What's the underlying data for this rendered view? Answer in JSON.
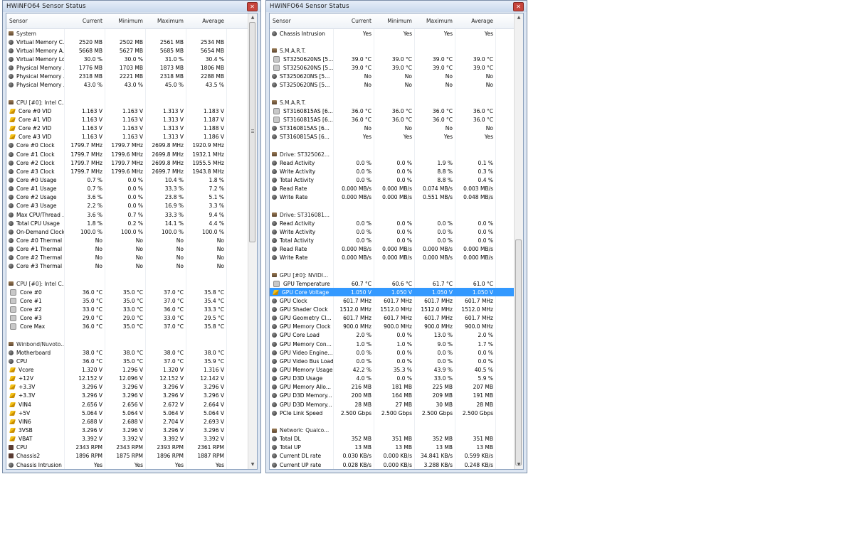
{
  "colors": {
    "selection": "#3399ff",
    "title_bar": "#c9d8ec"
  },
  "columns": [
    "Sensor",
    "Current",
    "Minimum",
    "Maximum",
    "Average"
  ],
  "left_window": {
    "title": "HWiNFO64 Sensor Status",
    "rows": [
      {
        "type": "group",
        "icon": "chip-icon",
        "name": "System"
      },
      {
        "icon": "sensor-icon",
        "name": "Virtual Memory C...",
        "cur": "2520 MB",
        "min": "2502 MB",
        "max": "2561 MB",
        "avg": "2534 MB"
      },
      {
        "icon": "sensor-icon",
        "name": "Virtual Memory A...",
        "cur": "5668 MB",
        "min": "5627 MB",
        "max": "5685 MB",
        "avg": "5654 MB"
      },
      {
        "icon": "sensor-icon",
        "name": "Virtual Memory Load",
        "cur": "30.0 %",
        "min": "30.0 %",
        "max": "31.0 %",
        "avg": "30.4 %"
      },
      {
        "icon": "sensor-icon",
        "name": "Physical Memory ...",
        "cur": "1776 MB",
        "min": "1703 MB",
        "max": "1873 MB",
        "avg": "1806 MB"
      },
      {
        "icon": "sensor-icon",
        "name": "Physical Memory ...",
        "cur": "2318 MB",
        "min": "2221 MB",
        "max": "2318 MB",
        "avg": "2288 MB"
      },
      {
        "icon": "sensor-icon",
        "name": "Physical Memory ...",
        "cur": "43.0 %",
        "min": "43.0 %",
        "max": "45.0 %",
        "avg": "43.5 %"
      },
      {
        "type": "blank"
      },
      {
        "type": "group",
        "icon": "chip-icon",
        "name": "CPU [#0]: Intel C..."
      },
      {
        "icon": "voltage-icon",
        "name": "Core #0 VID",
        "cur": "1.163 V",
        "min": "1.163 V",
        "max": "1.313 V",
        "avg": "1.183 V"
      },
      {
        "icon": "voltage-icon",
        "name": "Core #1 VID",
        "cur": "1.163 V",
        "min": "1.163 V",
        "max": "1.313 V",
        "avg": "1.187 V"
      },
      {
        "icon": "voltage-icon",
        "name": "Core #2 VID",
        "cur": "1.163 V",
        "min": "1.163 V",
        "max": "1.313 V",
        "avg": "1.188 V"
      },
      {
        "icon": "voltage-icon",
        "name": "Core #3 VID",
        "cur": "1.163 V",
        "min": "1.163 V",
        "max": "1.313 V",
        "avg": "1.186 V"
      },
      {
        "icon": "sensor-icon",
        "name": "Core #0 Clock",
        "cur": "1799.7 MHz",
        "min": "1799.7 MHz",
        "max": "2699.8 MHz",
        "avg": "1920.9 MHz"
      },
      {
        "icon": "sensor-icon",
        "name": "Core #1 Clock",
        "cur": "1799.7 MHz",
        "min": "1799.6 MHz",
        "max": "2699.8 MHz",
        "avg": "1932.1 MHz"
      },
      {
        "icon": "sensor-icon",
        "name": "Core #2 Clock",
        "cur": "1799.7 MHz",
        "min": "1799.7 MHz",
        "max": "2699.8 MHz",
        "avg": "1955.5 MHz"
      },
      {
        "icon": "sensor-icon",
        "name": "Core #3 Clock",
        "cur": "1799.7 MHz",
        "min": "1799.6 MHz",
        "max": "2699.7 MHz",
        "avg": "1943.8 MHz"
      },
      {
        "icon": "sensor-icon",
        "name": "Core #0 Usage",
        "cur": "0.7 %",
        "min": "0.0 %",
        "max": "10.4 %",
        "avg": "1.8 %"
      },
      {
        "icon": "sensor-icon",
        "name": "Core #1 Usage",
        "cur": "0.7 %",
        "min": "0.0 %",
        "max": "33.3 %",
        "avg": "7.2 %"
      },
      {
        "icon": "sensor-icon",
        "name": "Core #2 Usage",
        "cur": "3.6 %",
        "min": "0.0 %",
        "max": "23.8 %",
        "avg": "5.1 %"
      },
      {
        "icon": "sensor-icon",
        "name": "Core #3 Usage",
        "cur": "2.2 %",
        "min": "0.0 %",
        "max": "16.9 %",
        "avg": "3.3 %"
      },
      {
        "icon": "sensor-icon",
        "name": "Max CPU/Thread ...",
        "cur": "3.6 %",
        "min": "0.7 %",
        "max": "33.3 %",
        "avg": "9.4 %"
      },
      {
        "icon": "sensor-icon",
        "name": "Total CPU Usage",
        "cur": "1.8 %",
        "min": "0.2 %",
        "max": "14.1 %",
        "avg": "4.4 %"
      },
      {
        "icon": "sensor-icon",
        "name": "On-Demand Clock...",
        "cur": "100.0 %",
        "min": "100.0 %",
        "max": "100.0 %",
        "avg": "100.0 %"
      },
      {
        "icon": "sensor-icon",
        "name": "Core #0 Thermal ...",
        "cur": "No",
        "min": "No",
        "max": "No",
        "avg": "No"
      },
      {
        "icon": "sensor-icon",
        "name": "Core #1 Thermal ...",
        "cur": "No",
        "min": "No",
        "max": "No",
        "avg": "No"
      },
      {
        "icon": "sensor-icon",
        "name": "Core #2 Thermal ...",
        "cur": "No",
        "min": "No",
        "max": "No",
        "avg": "No"
      },
      {
        "icon": "sensor-icon",
        "name": "Core #3 Thermal ...",
        "cur": "No",
        "min": "No",
        "max": "No",
        "avg": "No"
      },
      {
        "type": "blank"
      },
      {
        "type": "group",
        "icon": "chip-icon",
        "name": "CPU [#0]: Intel C..."
      },
      {
        "icon": "thermometer-icon",
        "name": "Core #0",
        "cur": "36.0 °C",
        "min": "35.0 °C",
        "max": "37.0 °C",
        "avg": "35.8 °C"
      },
      {
        "icon": "thermometer-icon",
        "name": "Core #1",
        "cur": "35.0 °C",
        "min": "35.0 °C",
        "max": "37.0 °C",
        "avg": "35.4 °C"
      },
      {
        "icon": "thermometer-icon",
        "name": "Core #2",
        "cur": "33.0 °C",
        "min": "33.0 °C",
        "max": "36.0 °C",
        "avg": "33.3 °C"
      },
      {
        "icon": "thermometer-icon",
        "name": "Core #3",
        "cur": "29.0 °C",
        "min": "29.0 °C",
        "max": "33.0 °C",
        "avg": "29.5 °C"
      },
      {
        "icon": "thermometer-icon",
        "name": "Core Max",
        "cur": "36.0 °C",
        "min": "35.0 °C",
        "max": "37.0 °C",
        "avg": "35.8 °C"
      },
      {
        "type": "blank"
      },
      {
        "type": "group",
        "icon": "chip-icon",
        "name": "Winbond/Nuvoto..."
      },
      {
        "icon": "sensor-icon",
        "name": "Motherboard",
        "cur": "38.0 °C",
        "min": "38.0 °C",
        "max": "38.0 °C",
        "avg": "38.0 °C"
      },
      {
        "icon": "sensor-icon",
        "name": "CPU",
        "cur": "36.0 °C",
        "min": "35.0 °C",
        "max": "37.0 °C",
        "avg": "35.9 °C"
      },
      {
        "icon": "voltage-icon",
        "name": "Vcore",
        "cur": "1.320 V",
        "min": "1.296 V",
        "max": "1.320 V",
        "avg": "1.316 V"
      },
      {
        "icon": "voltage-icon",
        "name": "+12V",
        "cur": "12.152 V",
        "min": "12.096 V",
        "max": "12.152 V",
        "avg": "12.142 V"
      },
      {
        "icon": "voltage-icon",
        "name": "+3.3V",
        "cur": "3.296 V",
        "min": "3.296 V",
        "max": "3.296 V",
        "avg": "3.296 V"
      },
      {
        "icon": "voltage-icon",
        "name": "+3.3V",
        "cur": "3.296 V",
        "min": "3.296 V",
        "max": "3.296 V",
        "avg": "3.296 V"
      },
      {
        "icon": "voltage-icon",
        "name": "VIN4",
        "cur": "2.656 V",
        "min": "2.656 V",
        "max": "2.672 V",
        "avg": "2.664 V"
      },
      {
        "icon": "voltage-icon",
        "name": "+5V",
        "cur": "5.064 V",
        "min": "5.064 V",
        "max": "5.064 V",
        "avg": "5.064 V"
      },
      {
        "icon": "voltage-icon",
        "name": "VIN6",
        "cur": "2.688 V",
        "min": "2.688 V",
        "max": "2.704 V",
        "avg": "2.693 V"
      },
      {
        "icon": "voltage-icon",
        "name": "3VSB",
        "cur": "3.296 V",
        "min": "3.296 V",
        "max": "3.296 V",
        "avg": "3.296 V"
      },
      {
        "icon": "voltage-icon",
        "name": "VBAT",
        "cur": "3.392 V",
        "min": "3.392 V",
        "max": "3.392 V",
        "avg": "3.392 V"
      },
      {
        "icon": "fan-icon",
        "name": "CPU",
        "cur": "2343 RPM",
        "min": "2343 RPM",
        "max": "2393 RPM",
        "avg": "2361 RPM"
      },
      {
        "icon": "fan-icon",
        "name": "Chassis2",
        "cur": "1896 RPM",
        "min": "1875 RPM",
        "max": "1896 RPM",
        "avg": "1887 RPM"
      },
      {
        "icon": "sensor-icon",
        "name": "Chassis Intrusion",
        "cur": "Yes",
        "min": "Yes",
        "max": "Yes",
        "avg": "Yes"
      }
    ]
  },
  "right_window": {
    "title": "HWiNFO64 Sensor Status",
    "rows": [
      {
        "icon": "sensor-icon",
        "name": "Chassis Intrusion",
        "cur": "Yes",
        "min": "Yes",
        "max": "Yes",
        "avg": "Yes"
      },
      {
        "type": "blank"
      },
      {
        "type": "group",
        "icon": "chip-icon",
        "name": "S.M.A.R.T."
      },
      {
        "icon": "thermometer-icon",
        "name": "ST3250620NS [5...",
        "cur": "39.0 °C",
        "min": "39.0 °C",
        "max": "39.0 °C",
        "avg": "39.0 °C"
      },
      {
        "icon": "thermometer-icon",
        "name": "ST3250620NS [5...",
        "cur": "39.0 °C",
        "min": "39.0 °C",
        "max": "39.0 °C",
        "avg": "39.0 °C"
      },
      {
        "icon": "sensor-icon",
        "name": "ST3250620NS [5...",
        "cur": "No",
        "min": "No",
        "max": "No",
        "avg": "No"
      },
      {
        "icon": "sensor-icon",
        "name": "ST3250620NS [5...",
        "cur": "No",
        "min": "No",
        "max": "No",
        "avg": "No"
      },
      {
        "type": "blank"
      },
      {
        "type": "group",
        "icon": "chip-icon",
        "name": "S.M.A.R.T."
      },
      {
        "icon": "thermometer-icon",
        "name": "ST3160815AS [6...",
        "cur": "36.0 °C",
        "min": "36.0 °C",
        "max": "36.0 °C",
        "avg": "36.0 °C"
      },
      {
        "icon": "thermometer-icon",
        "name": "ST3160815AS [6...",
        "cur": "36.0 °C",
        "min": "36.0 °C",
        "max": "36.0 °C",
        "avg": "36.0 °C"
      },
      {
        "icon": "sensor-icon",
        "name": "ST3160815AS [6...",
        "cur": "No",
        "min": "No",
        "max": "No",
        "avg": "No"
      },
      {
        "icon": "sensor-icon",
        "name": "ST3160815AS [6...",
        "cur": "Yes",
        "min": "Yes",
        "max": "Yes",
        "avg": "Yes"
      },
      {
        "type": "blank"
      },
      {
        "type": "group",
        "icon": "chip-icon",
        "name": "Drive: ST325062..."
      },
      {
        "icon": "sensor-icon",
        "name": "Read Activity",
        "cur": "0.0 %",
        "min": "0.0 %",
        "max": "1.9 %",
        "avg": "0.1 %"
      },
      {
        "icon": "sensor-icon",
        "name": "Write Activity",
        "cur": "0.0 %",
        "min": "0.0 %",
        "max": "8.8 %",
        "avg": "0.3 %"
      },
      {
        "icon": "sensor-icon",
        "name": "Total Activity",
        "cur": "0.0 %",
        "min": "0.0 %",
        "max": "8.8 %",
        "avg": "0.4 %"
      },
      {
        "icon": "sensor-icon",
        "name": "Read Rate",
        "cur": "0.000 MB/s",
        "min": "0.000 MB/s",
        "max": "0.074 MB/s",
        "avg": "0.003 MB/s"
      },
      {
        "icon": "sensor-icon",
        "name": "Write Rate",
        "cur": "0.000 MB/s",
        "min": "0.000 MB/s",
        "max": "0.551 MB/s",
        "avg": "0.048 MB/s"
      },
      {
        "type": "blank"
      },
      {
        "type": "group",
        "icon": "chip-icon",
        "name": "Drive: ST316081..."
      },
      {
        "icon": "sensor-icon",
        "name": "Read Activity",
        "cur": "0.0 %",
        "min": "0.0 %",
        "max": "0.0 %",
        "avg": "0.0 %"
      },
      {
        "icon": "sensor-icon",
        "name": "Write Activity",
        "cur": "0.0 %",
        "min": "0.0 %",
        "max": "0.0 %",
        "avg": "0.0 %"
      },
      {
        "icon": "sensor-icon",
        "name": "Total Activity",
        "cur": "0.0 %",
        "min": "0.0 %",
        "max": "0.0 %",
        "avg": "0.0 %"
      },
      {
        "icon": "sensor-icon",
        "name": "Read Rate",
        "cur": "0.000 MB/s",
        "min": "0.000 MB/s",
        "max": "0.000 MB/s",
        "avg": "0.000 MB/s"
      },
      {
        "icon": "sensor-icon",
        "name": "Write Rate",
        "cur": "0.000 MB/s",
        "min": "0.000 MB/s",
        "max": "0.000 MB/s",
        "avg": "0.000 MB/s"
      },
      {
        "type": "blank"
      },
      {
        "type": "group",
        "icon": "chip-icon",
        "name": "GPU [#0]: NVIDI..."
      },
      {
        "icon": "thermometer-icon",
        "name": "GPU Temperature",
        "cur": "60.7 °C",
        "min": "60.6 °C",
        "max": "61.7 °C",
        "avg": "61.0 °C"
      },
      {
        "icon": "voltage-icon",
        "name": "GPU Core Voltage",
        "cur": "1.050 V",
        "min": "1.050 V",
        "max": "1.050 V",
        "avg": "1.050 V",
        "selected": true
      },
      {
        "icon": "sensor-icon",
        "name": "GPU Clock",
        "cur": "601.7 MHz",
        "min": "601.7 MHz",
        "max": "601.7 MHz",
        "avg": "601.7 MHz"
      },
      {
        "icon": "sensor-icon",
        "name": "GPU Shader Clock",
        "cur": "1512.0 MHz",
        "min": "1512.0 MHz",
        "max": "1512.0 MHz",
        "avg": "1512.0 MHz"
      },
      {
        "icon": "sensor-icon",
        "name": "GPU Geometry Cl...",
        "cur": "601.7 MHz",
        "min": "601.7 MHz",
        "max": "601.7 MHz",
        "avg": "601.7 MHz"
      },
      {
        "icon": "sensor-icon",
        "name": "GPU Memory Clock",
        "cur": "900.0 MHz",
        "min": "900.0 MHz",
        "max": "900.0 MHz",
        "avg": "900.0 MHz"
      },
      {
        "icon": "sensor-icon",
        "name": "GPU Core Load",
        "cur": "2.0 %",
        "min": "0.0 %",
        "max": "13.0 %",
        "avg": "2.0 %"
      },
      {
        "icon": "sensor-icon",
        "name": "GPU Memory Con...",
        "cur": "1.0 %",
        "min": "1.0 %",
        "max": "9.0 %",
        "avg": "1.7 %"
      },
      {
        "icon": "sensor-icon",
        "name": "GPU Video Engine...",
        "cur": "0.0 %",
        "min": "0.0 %",
        "max": "0.0 %",
        "avg": "0.0 %"
      },
      {
        "icon": "sensor-icon",
        "name": "GPU Video Bus Load",
        "cur": "0.0 %",
        "min": "0.0 %",
        "max": "0.0 %",
        "avg": "0.0 %"
      },
      {
        "icon": "sensor-icon",
        "name": "GPU Memory Usage",
        "cur": "42.2 %",
        "min": "35.3 %",
        "max": "43.9 %",
        "avg": "40.5 %"
      },
      {
        "icon": "sensor-icon",
        "name": "GPU D3D Usage",
        "cur": "4.0 %",
        "min": "0.0 %",
        "max": "33.0 %",
        "avg": "5.9 %"
      },
      {
        "icon": "sensor-icon",
        "name": "GPU Memory Allo...",
        "cur": "216 MB",
        "min": "181 MB",
        "max": "225 MB",
        "avg": "207 MB"
      },
      {
        "icon": "sensor-icon",
        "name": "GPU D3D Memory...",
        "cur": "200 MB",
        "min": "164 MB",
        "max": "209 MB",
        "avg": "191 MB"
      },
      {
        "icon": "sensor-icon",
        "name": "GPU D3D Memory...",
        "cur": "28 MB",
        "min": "27 MB",
        "max": "30 MB",
        "avg": "28 MB"
      },
      {
        "icon": "sensor-icon",
        "name": "PCIe Link Speed",
        "cur": "2.500 Gbps",
        "min": "2.500 Gbps",
        "max": "2.500 Gbps",
        "avg": "2.500 Gbps"
      },
      {
        "type": "blank"
      },
      {
        "type": "group",
        "icon": "chip-icon",
        "name": "Network: Qualco..."
      },
      {
        "icon": "sensor-icon",
        "name": "Total DL",
        "cur": "352 MB",
        "min": "351 MB",
        "max": "352 MB",
        "avg": "351 MB"
      },
      {
        "icon": "sensor-icon",
        "name": "Total UP",
        "cur": "13 MB",
        "min": "13 MB",
        "max": "13 MB",
        "avg": "13 MB"
      },
      {
        "icon": "sensor-icon",
        "name": "Current DL rate",
        "cur": "0.030 KB/s",
        "min": "0.000 KB/s",
        "max": "34.841 KB/s",
        "avg": "0.599 KB/s"
      },
      {
        "icon": "sensor-icon",
        "name": "Current UP rate",
        "cur": "0.028 KB/s",
        "min": "0.000 KB/s",
        "max": "3.288 KB/s",
        "avg": "0.248 KB/s"
      }
    ]
  }
}
